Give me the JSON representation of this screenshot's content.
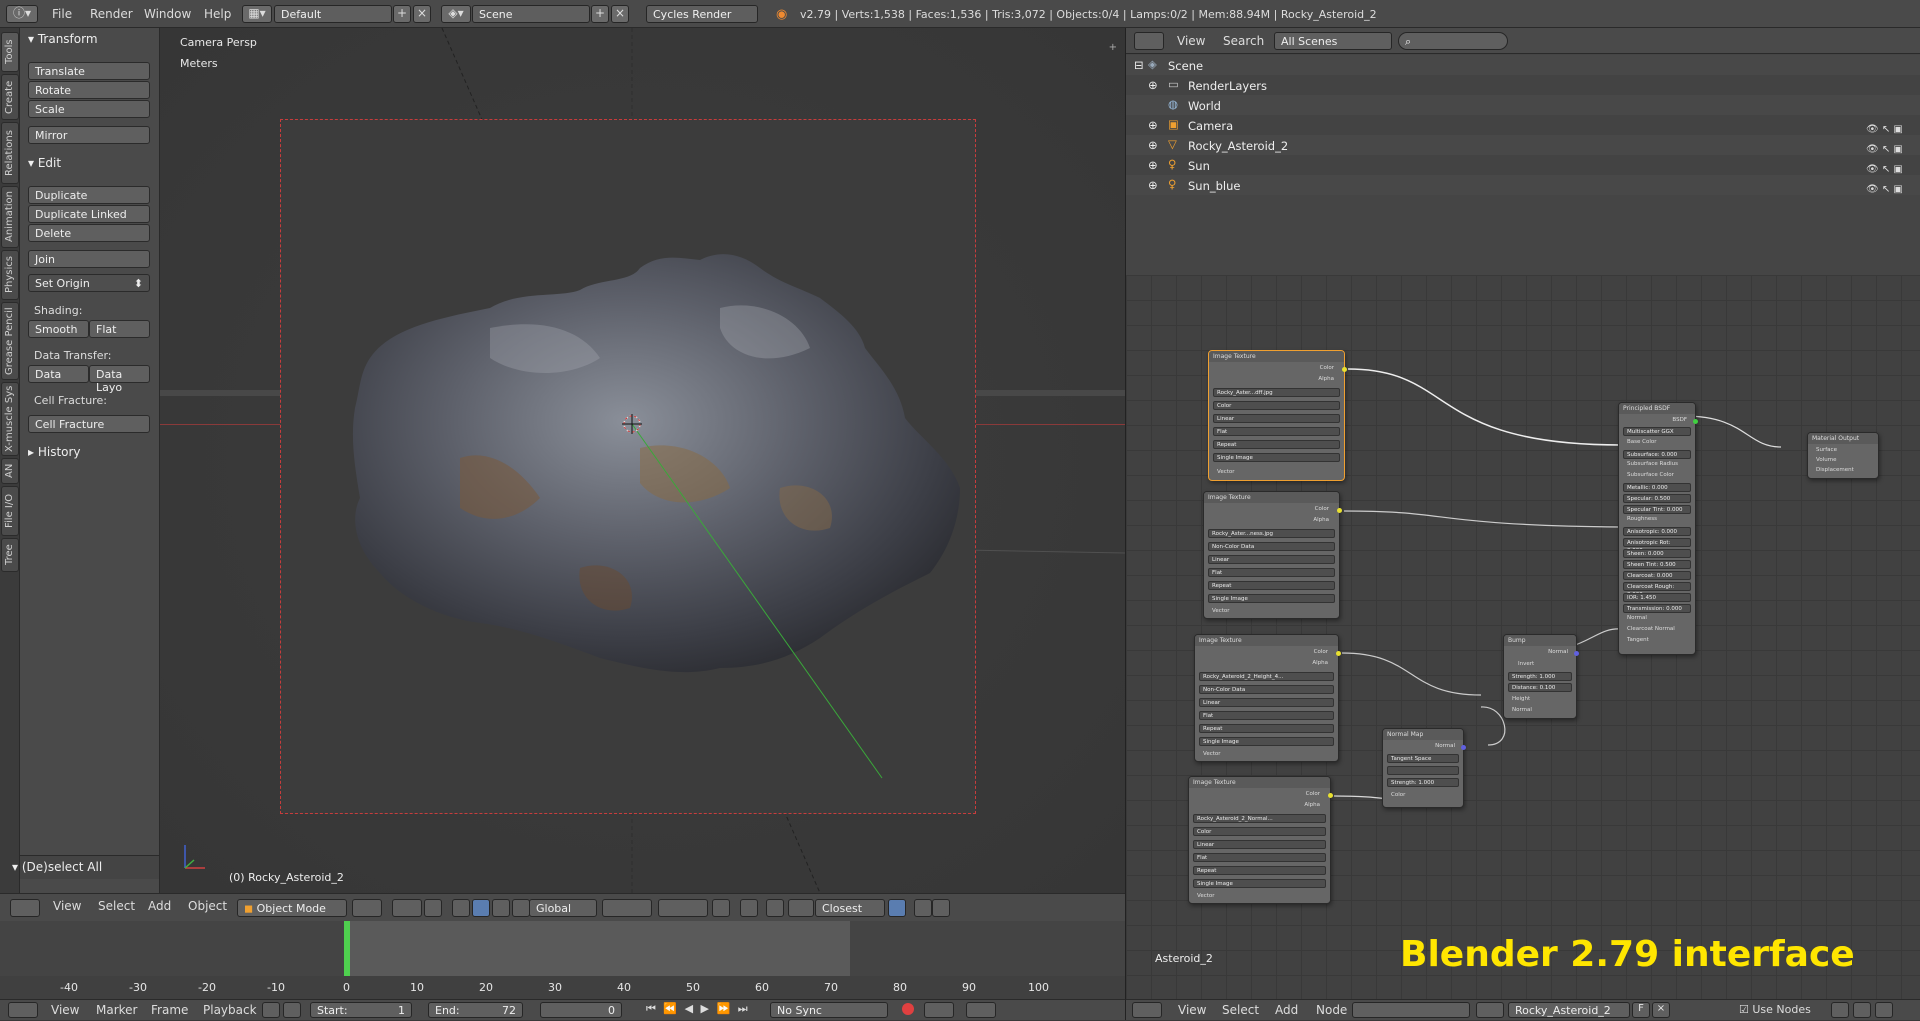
{
  "topbar": {
    "menus": [
      "File",
      "Render",
      "Window",
      "Help"
    ],
    "layout": "Default",
    "scene": "Scene",
    "engine": "Cycles Render",
    "stats": "v2.79 | Verts:1,538 | Faces:1,536 | Tris:3,072 | Objects:0/4 | Lamps:0/2 | Mem:88.94M | Rocky_Asteroid_2"
  },
  "lefttabs": [
    "Tools",
    "Create",
    "Relations",
    "Animation",
    "Physics",
    "Grease Pencil",
    "X-muscle Sys",
    "AN",
    "File I/O",
    "Tree"
  ],
  "toolshelf": {
    "transform_header": "Transform",
    "translate": "Translate",
    "rotate": "Rotate",
    "scale": "Scale",
    "mirror": "Mirror",
    "edit_header": "Edit",
    "duplicate": "Duplicate",
    "duplicate_linked": "Duplicate Linked",
    "delete": "Delete",
    "join": "Join",
    "set_origin": "Set Origin",
    "shading_label": "Shading:",
    "smooth": "Smooth",
    "flat": "Flat",
    "data_transfer_label": "Data Transfer:",
    "data": "Data",
    "data_layout": "Data Layo",
    "cell_fracture_label": "Cell Fracture:",
    "cell_fracture": "Cell Fracture",
    "history_header": "History",
    "deselect_all": "(De)select All"
  },
  "viewport": {
    "view_name": "Camera Persp",
    "units": "Meters",
    "object_label": "(0) Rocky_Asteroid_2"
  },
  "vpheader": {
    "view": "View",
    "select": "Select",
    "add": "Add",
    "object": "Object",
    "mode": "Object Mode",
    "orientation": "Global",
    "snap": "Closest"
  },
  "timeline": {
    "ticks": [
      "-40",
      "-30",
      "-20",
      "-10",
      "0",
      "10",
      "20",
      "30",
      "40",
      "50",
      "60",
      "70",
      "80",
      "90",
      "100"
    ],
    "current_frame_marker": 0
  },
  "tlbar": {
    "view": "View",
    "marker": "Marker",
    "frame": "Frame",
    "playback": "Playback",
    "start_label": "Start:",
    "start": "1",
    "end_label": "End:",
    "end": "72",
    "current": "0",
    "sync": "No Sync"
  },
  "outliner": {
    "view": "View",
    "search": "Search",
    "filter": "All Scenes",
    "items": [
      {
        "label": "Scene"
      },
      {
        "label": "RenderLayers"
      },
      {
        "label": "World"
      },
      {
        "label": "Camera"
      },
      {
        "label": "Rocky_Asteroid_2"
      },
      {
        "label": "Sun"
      },
      {
        "label": "Sun_blue"
      }
    ]
  },
  "nodeeditor": {
    "material_name": "Asteroid_2",
    "watermark": "Blender 2.79 interface",
    "header": {
      "view": "View",
      "select": "Select",
      "add": "Add",
      "node": "Node",
      "material": "Rocky_Asteroid_2",
      "fake_user": "F",
      "use_nodes": "Use Nodes"
    },
    "tex1": {
      "title": "Image Texture",
      "img": "Rocky_Aster...dff.jpg",
      "color_space": "Color",
      "interp": "Linear",
      "proj": "Flat",
      "ext": "Repeat",
      "src": "Single Image",
      "color": "Color",
      "alpha": "Alpha",
      "vector": "Vector"
    },
    "tex2": {
      "title": "Image Texture",
      "img": "Rocky_Aster...ness.jpg",
      "color_space": "Non-Color Data",
      "interp": "Linear",
      "proj": "Flat",
      "ext": "Repeat",
      "src": "Single Image",
      "color": "Color",
      "alpha": "Alpha",
      "vector": "Vector"
    },
    "tex3": {
      "title": "Image Texture",
      "img": "Rocky_Asteroid_2_Height_4...",
      "color_space": "Non-Color Data",
      "interp": "Linear",
      "proj": "Flat",
      "ext": "Repeat",
      "src": "Single Image",
      "color": "Color",
      "alpha": "Alpha",
      "vector": "Vector"
    },
    "tex4": {
      "title": "Image Texture",
      "img": "Rocky_Asteroid_2_Normal...",
      "color_space": "Color",
      "interp": "Linear",
      "proj": "Flat",
      "ext": "Repeat",
      "src": "Single Image",
      "color": "Color",
      "alpha": "Alpha",
      "vector": "Vector"
    },
    "bump": {
      "title": "Bump",
      "invert": "Invert",
      "strength": "Strength: 1.000",
      "distance": "Distance: 0.100",
      "height": "Height",
      "normal": "Normal",
      "out": "Normal"
    },
    "normalmap": {
      "title": "Normal Map",
      "space": "Tangent Space",
      "strength": "Strength: 1.000",
      "color": "Color",
      "out": "Normal"
    },
    "principled": {
      "title": "Principled BSDF",
      "bsdf": "BSDF",
      "dist": "Multiscatter GGX",
      "sub": "Subsurface Radius",
      "rows": [
        "Base Color",
        "Subsurface: 0.000",
        "Subsurface Radius",
        "Subsurface Color",
        "Metallic: 0.000",
        "Specular: 0.500",
        "Specular Tint: 0.000",
        "Roughness",
        "Anisotropic: 0.000",
        "Anisotropic Rot: 0.000",
        "Sheen: 0.000",
        "Sheen Tint: 0.500",
        "Clearcoat: 0.000",
        "Clearcoat Rough: 0.030",
        "IOR: 1.450",
        "Transmission: 0.000",
        "Normal",
        "Clearcoat Normal",
        "Tangent"
      ]
    },
    "output": {
      "title": "Material Output",
      "surface": "Surface",
      "volume": "Volume",
      "disp": "Displacement"
    }
  }
}
